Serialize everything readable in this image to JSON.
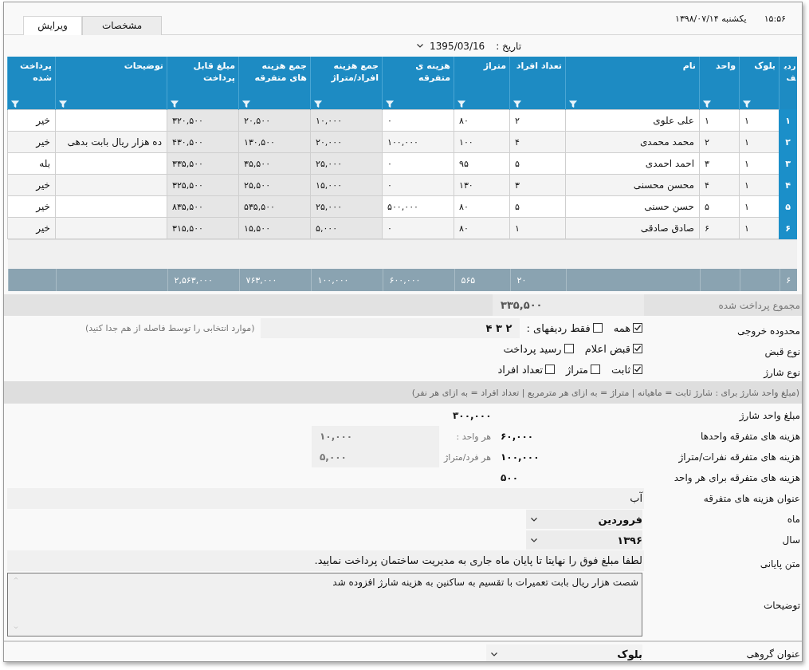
{
  "header": {
    "time": "۱۵:۵۶",
    "date": "یکشنبه ۱۳۹۸/۰۷/۱۴"
  },
  "tabs": [
    {
      "label": "مشخصات",
      "selected": false
    },
    {
      "label": "ویرایش",
      "selected": true
    }
  ],
  "date_filter": {
    "label": "تاریخ :",
    "value": "1395/03/16"
  },
  "table": {
    "columns": [
      {
        "label": "ردیف",
        "filter": false,
        "shaded": false
      },
      {
        "label": "بلوک",
        "filter": true,
        "shaded": false
      },
      {
        "label": "واحد",
        "filter": true,
        "shaded": false
      },
      {
        "label": "نام",
        "filter": true,
        "shaded": false
      },
      {
        "label": "تعداد افراد",
        "filter": true,
        "shaded": false
      },
      {
        "label": "متراژ",
        "filter": true,
        "shaded": false
      },
      {
        "label": "هزینه ی متفرقه",
        "filter": true,
        "shaded": false
      },
      {
        "label": "جمع هزینه افراد/متراژ",
        "filter": true,
        "shaded": true
      },
      {
        "label": "جمع هزینه های متفرقه",
        "filter": true,
        "shaded": true
      },
      {
        "label": "مبلغ قابل پرداخت",
        "filter": true,
        "shaded": true
      },
      {
        "label": "توضیحات",
        "filter": true,
        "shaded": false
      },
      {
        "label": "پرداخت شده",
        "filter": true,
        "shaded": false
      }
    ],
    "rows": [
      {
        "num": "۱",
        "block": "۱",
        "unit": "۱",
        "name": "علی علوی",
        "people": "۲",
        "area": "۸۰",
        "misc": "۰",
        "sum_people": "۱۰,۰۰۰",
        "sum_misc": "۲۰,۵۰۰",
        "payable": "۳۲۰,۵۰۰",
        "paid": "خیر"
      },
      {
        "num": "۲",
        "block": "۱",
        "unit": "۲",
        "name": "محمد محمدی",
        "people": "۴",
        "area": "۱۰۰",
        "misc": "۱۰۰,۰۰۰",
        "sum_people": "۲۰,۰۰۰",
        "sum_misc": "۱۳۰,۵۰۰",
        "payable": "۴۳۰,۵۰۰",
        "note": "ده هزار ریال بابت بدهی",
        "paid": "خیر"
      },
      {
        "num": "۳",
        "block": "۱",
        "unit": "۳",
        "name": "احمد احمدی",
        "people": "۵",
        "area": "۹۵",
        "misc": "۰",
        "sum_people": "۲۵,۰۰۰",
        "sum_misc": "۳۵,۵۰۰",
        "payable": "۳۳۵,۵۰۰",
        "paid": "بله"
      },
      {
        "num": "۴",
        "block": "۱",
        "unit": "۴",
        "name": "محسن محسنی",
        "people": "۳",
        "area": "۱۳۰",
        "misc": "۰",
        "sum_people": "۱۵,۰۰۰",
        "sum_misc": "۲۵,۵۰۰",
        "payable": "۳۲۵,۵۰۰",
        "paid": "خیر"
      },
      {
        "num": "۵",
        "block": "۱",
        "unit": "۵",
        "name": "حسن حسنی",
        "people": "۵",
        "area": "۸۰",
        "misc": "۵۰۰,۰۰۰",
        "sum_people": "۲۵,۰۰۰",
        "sum_misc": "۵۳۵,۵۰۰",
        "payable": "۸۳۵,۵۰۰",
        "paid": "خیر"
      },
      {
        "num": "۶",
        "block": "۱",
        "unit": "۶",
        "name": "صادق صادقی",
        "people": "۱",
        "area": "۸۰",
        "misc": "۰",
        "sum_people": "۵,۰۰۰",
        "sum_misc": "۱۵,۵۰۰",
        "payable": "۳۱۵,۵۰۰",
        "paid": "خیر"
      }
    ],
    "totals": {
      "num": "۶",
      "people": "۲۰",
      "area": "۵۶۵",
      "misc": "۶۰۰,۰۰۰",
      "sum_people": "۱۰۰,۰۰۰",
      "sum_misc": "۷۶۳,۰۰۰",
      "payable": "۲,۵۶۳,۰۰۰"
    }
  },
  "form": [
    {
      "kind": "total",
      "label": "مجموع پرداخت شده",
      "value": "۳۳۵,۵۰۰"
    },
    {
      "kind": "checks",
      "label": "محدوده خروجی",
      "options": [
        {
          "label": "همه",
          "checked": true
        },
        {
          "label": "فقط ردیفهای :",
          "checked": false
        }
      ],
      "value": "۲ ۳ ۴",
      "hint": "(موارد انتخابی را توسط فاصله از هم جدا کنید)"
    },
    {
      "kind": "checks",
      "label": "نوع قبض",
      "options": [
        {
          "label": "قبض اعلام",
          "checked": true
        },
        {
          "label": "رسید پرداخت",
          "checked": false
        }
      ]
    },
    {
      "kind": "checks",
      "label": "نوع شارژ",
      "options": [
        {
          "label": "ثابت",
          "checked": true
        },
        {
          "label": "متراژ",
          "checked": false
        },
        {
          "label": "تعداد افراد",
          "checked": false
        }
      ]
    },
    {
      "kind": "note",
      "text": "(مبلغ واحد شارژ برای : شارژ ثابت = ماهیانه  |  متراژ = به ازای هر مترمربع  |  تعداد افراد = به ازای هر نفر)"
    },
    {
      "kind": "amount",
      "label": "مبلغ واحد شارژ",
      "value": "۳۰۰,۰۰۰"
    },
    {
      "kind": "split",
      "label": "هزینه های متفرقه واحدها",
      "value": "۶۰,۰۰۰",
      "per_label": "هر واحد :",
      "per_value": "۱۰,۰۰۰"
    },
    {
      "kind": "split",
      "label": "هزینه های متفرقه نفرات/متراژ",
      "value": "۱۰۰,۰۰۰",
      "per_label": "هر فرد/متراژ",
      "per_value": "۵,۰۰۰"
    },
    {
      "kind": "split",
      "label": "هزینه های متفرقه برای هر واحد",
      "value": "۵۰۰"
    },
    {
      "kind": "text",
      "label": "عنوان هزینه های متفرقه",
      "value": "آب"
    },
    {
      "kind": "select",
      "label": "ماه",
      "value": "فروردین"
    },
    {
      "kind": "select",
      "label": "سال",
      "value": "۱۳۹۶"
    },
    {
      "kind": "footer",
      "label": "متن پایانی",
      "value": "لطفا مبلغ فوق را نهایتا تا پایان ماه جاری به مدیریت ساختمان پرداخت نمایید."
    },
    {
      "kind": "textarea",
      "label": "توضیحات",
      "value": "شصت هزار ریال بابت تعمیرات با تقسیم به ساکنین به هزینه شارژ افزوده شد"
    },
    {
      "kind": "group",
      "label": "عنوان گروهی",
      "value": "بلوک"
    }
  ]
}
